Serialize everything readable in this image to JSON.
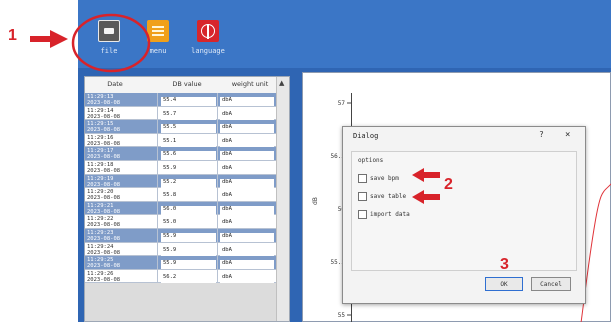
{
  "toolbar": {
    "buttons": [
      {
        "label": "file",
        "icon": "file-icon"
      },
      {
        "label": "menu",
        "icon": "menu-icon"
      },
      {
        "label": "language",
        "icon": "globe-icon"
      }
    ]
  },
  "table": {
    "headers": [
      "Date",
      "DB value",
      "weight unit"
    ],
    "rows": [
      {
        "date": [
          "11:29:13",
          "2023-08-08"
        ],
        "db": "55.4",
        "unit": "dbA"
      },
      {
        "date": [
          "11:29:14",
          "2023-08-08"
        ],
        "db": "55.7",
        "unit": "dbA"
      },
      {
        "date": [
          "11:29:15",
          "2023-08-08"
        ],
        "db": "55.5",
        "unit": "dbA"
      },
      {
        "date": [
          "11:29:16",
          "2023-08-08"
        ],
        "db": "55.1",
        "unit": "dbA"
      },
      {
        "date": [
          "11:29:17",
          "2023-08-08"
        ],
        "db": "55.6",
        "unit": "dbA"
      },
      {
        "date": [
          "11:29:18",
          "2023-08-08"
        ],
        "db": "55.9",
        "unit": "dbA"
      },
      {
        "date": [
          "11:29:19",
          "2023-08-08"
        ],
        "db": "55.2",
        "unit": "dbA"
      },
      {
        "date": [
          "11:29:20",
          "2023-08-08"
        ],
        "db": "55.8",
        "unit": "dbA"
      },
      {
        "date": [
          "11:29:21",
          "2023-08-08"
        ],
        "db": "56.0",
        "unit": "dbA"
      },
      {
        "date": [
          "11:29:22",
          "2023-08-08"
        ],
        "db": "55.0",
        "unit": "dbA"
      },
      {
        "date": [
          "11:29:23",
          "2023-08-08"
        ],
        "db": "55.9",
        "unit": "dbA"
      },
      {
        "date": [
          "11:29:24",
          "2023-08-08"
        ],
        "db": "55.9",
        "unit": "dbA"
      },
      {
        "date": [
          "11:29:25",
          "2023-08-08"
        ],
        "db": "55.9",
        "unit": "dbA"
      },
      {
        "date": [
          "11:29:26",
          "2023-08-08"
        ],
        "db": "56.2",
        "unit": "dbA"
      }
    ]
  },
  "chart": {
    "y_ticks": [
      "57",
      "56.5",
      "56",
      "55.5",
      "55"
    ],
    "ylabel": "dB"
  },
  "dialog": {
    "title": "Dialog",
    "help": "?",
    "close": "×",
    "group_title": "options",
    "options": [
      "save bpm",
      "save table",
      "import data"
    ],
    "ok_label": "OK",
    "cancel_label": "Cancel"
  },
  "annotations": {
    "step1": "1",
    "step2": "2",
    "step3": "3"
  },
  "colors": {
    "toolbar": "#3b76c6",
    "row_alt": "#7f9cc8",
    "annotation": "#d8232a"
  }
}
